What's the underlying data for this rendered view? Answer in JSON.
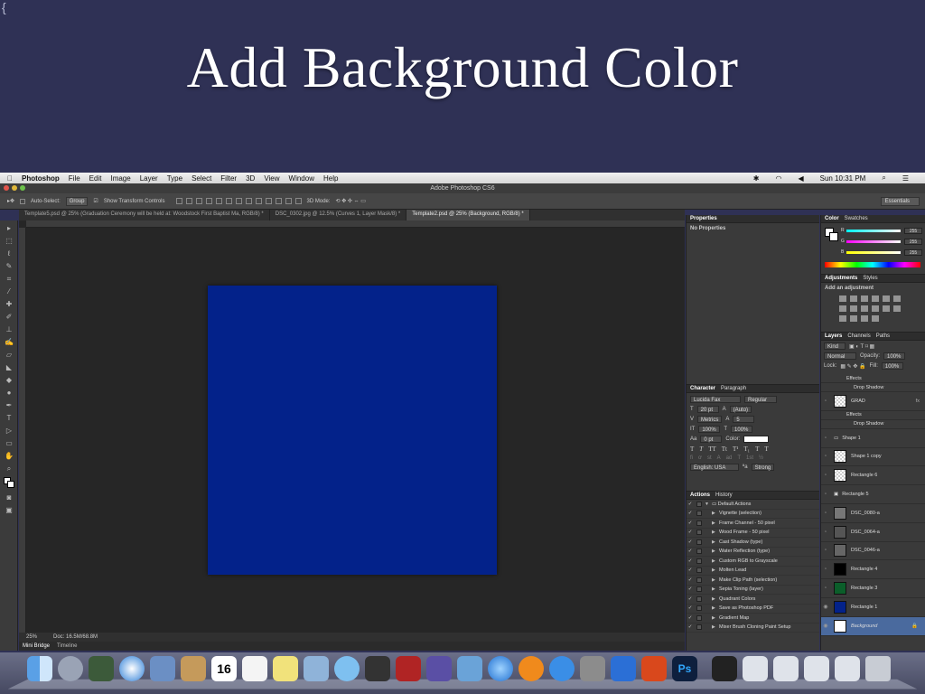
{
  "slide": {
    "title": "Add Background Color"
  },
  "menubar": {
    "apple": "",
    "items": [
      "Photoshop",
      "File",
      "Edit",
      "Image",
      "Layer",
      "Type",
      "Select",
      "Filter",
      "3D",
      "View",
      "Window",
      "Help"
    ],
    "clock": "Sun 10:31 PM"
  },
  "window": {
    "title": "Adobe Photoshop CS6"
  },
  "options": {
    "auto_select": "Auto-Select:",
    "group": "Group",
    "show_transform": "Show Transform Controls",
    "mode3d": "3D Mode:",
    "workspace": "Essentials"
  },
  "tabs": [
    {
      "label": "Template5.psd @ 25% (Graduation Ceremony will be held at: Woodstock First Baptist Ma, RGB/8) *"
    },
    {
      "label": "DSC_0302.jpg @ 12.5% (Curves 1, Layer Mask/8) *"
    },
    {
      "label": "Template2.psd @ 25% (Background, RGB/8) *"
    }
  ],
  "status": {
    "zoom": "25%",
    "doc": "Doc: 16.5M/68.8M"
  },
  "bottom_tabs": [
    "Mini Bridge",
    "Timeline"
  ],
  "canvas_color": "#03228a",
  "properties": {
    "tab": "Properties",
    "body": "No Properties"
  },
  "character": {
    "tabs": [
      "Character",
      "Paragraph"
    ],
    "font": "Lucida Fax",
    "style": "Regular",
    "size": "20 pt",
    "leading": "(Auto)",
    "kerning": "Metrics",
    "tracking": "5",
    "vscale": "100%",
    "hscale": "100%",
    "baseline": "0 pt",
    "color_label": "Color:",
    "language": "English: USA",
    "aa": "Strong"
  },
  "actions": {
    "tabs": [
      "Actions",
      "History"
    ],
    "items": [
      "Default Actions",
      "Vignette (selection)",
      "Frame Channel - 50 pixel",
      "Wood Frame - 50 pixel",
      "Cast Shadow (type)",
      "Water Reflection (type)",
      "Custom RGB to Grayscale",
      "Molten Lead",
      "Make Clip Path (selection)",
      "Sepia Toning (layer)",
      "Quadrant Colors",
      "Save as Photoshop PDF",
      "Gradient Map",
      "Mixer Brush Cloning Paint Setup"
    ]
  },
  "color_panel": {
    "tabs": [
      "Color",
      "Swatches"
    ],
    "r": "255",
    "g": "255",
    "b": "255"
  },
  "adjustments": {
    "tabs": [
      "Adjustments",
      "Styles"
    ],
    "label": "Add an adjustment"
  },
  "layers": {
    "tabs": [
      "Layers",
      "Channels",
      "Paths"
    ],
    "kind": "Kind",
    "blend": "Normal",
    "opacity_label": "Opacity:",
    "opacity": "100%",
    "lock_label": "Lock:",
    "fill_label": "Fill:",
    "fill": "100%",
    "rows": [
      {
        "name": "Effects"
      },
      {
        "name": "Drop Shadow"
      },
      {
        "name": "GRAD"
      },
      {
        "name": "Effects"
      },
      {
        "name": "Drop Shadow"
      },
      {
        "name": "Shape 1"
      },
      {
        "name": "Shape 1 copy"
      },
      {
        "name": "Rectangle 6"
      },
      {
        "name": "Rectangle 5"
      },
      {
        "name": "DSC_0080-a"
      },
      {
        "name": "DSC_0064-a"
      },
      {
        "name": "DSC_0046-a"
      },
      {
        "name": "Rectangle 4"
      },
      {
        "name": "Rectangle 3"
      },
      {
        "name": "Rectangle 1"
      },
      {
        "name": "Background"
      }
    ]
  }
}
